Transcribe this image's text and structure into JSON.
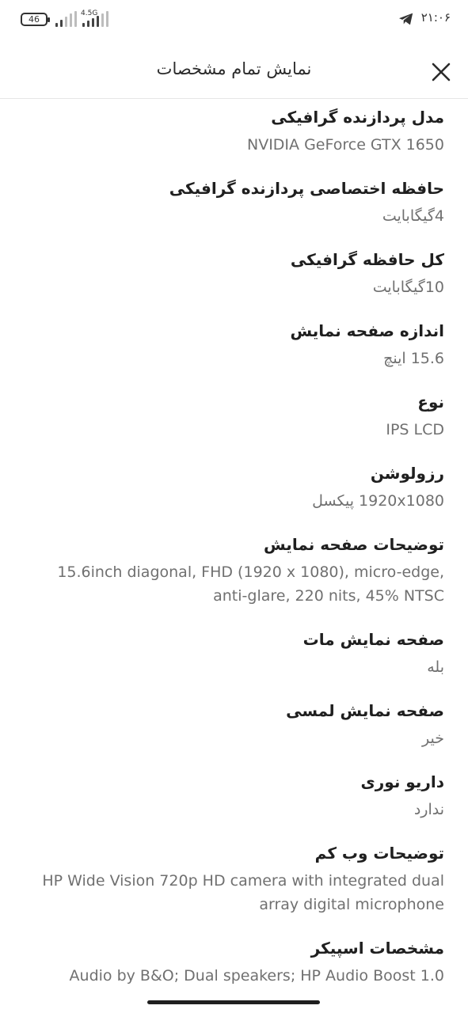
{
  "status_bar": {
    "battery": "46",
    "network": "4.5G",
    "time": "۲۱:۰۶"
  },
  "header": {
    "title": "نمایش تمام مشخصات"
  },
  "specs": [
    {
      "label": "مدل پردازنده گرافیکی",
      "value": "NVIDIA GeForce GTX 1650"
    },
    {
      "label": "حافظه اختصاصی پردازنده گرافیکی",
      "value": "4گیگابایت"
    },
    {
      "label": "کل حافظه گرافیکی",
      "value": "10گیگابایت"
    },
    {
      "label": "اندازه صفحه نمایش",
      "value": "15.6 اینچ"
    },
    {
      "label": "نوع",
      "value": "IPS LCD"
    },
    {
      "label": "رزولوشن",
      "value": "1920x1080 پیکسل"
    },
    {
      "label": "توضیحات صفحه نمایش",
      "value": "15.6inch diagonal, FHD (1920 x 1080), micro-edge, anti-glare, 220 nits, 45% NTSC"
    },
    {
      "label": "صفحه نمایش مات",
      "value": "بله"
    },
    {
      "label": "صفحه نمایش لمسی",
      "value": "خیر"
    },
    {
      "label": "داریو نوری",
      "value": "ندارد"
    },
    {
      "label": "توضیحات وب کم",
      "value": "HP Wide Vision 720p HD camera with integrated dual array digital microphone"
    },
    {
      "label": "مشخصات اسپیکر",
      "value": "Audio by B&O; Dual speakers; HP Audio Boost 1.0"
    }
  ],
  "icons": {
    "close": "close-icon",
    "telegram": "telegram-icon",
    "battery": "battery-icon",
    "signal": "signal-icon"
  }
}
